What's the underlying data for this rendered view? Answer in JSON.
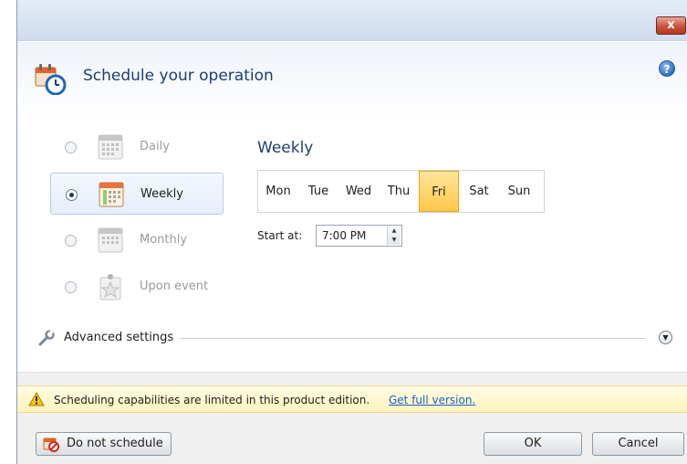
{
  "titlebar": {
    "close_label": "x"
  },
  "header": {
    "title": "Schedule your operation",
    "help_label": "?"
  },
  "schedule_options": [
    {
      "label": "Daily",
      "selected": false,
      "icon": "calendar-icon"
    },
    {
      "label": "Weekly",
      "selected": true,
      "icon": "calendar-week-icon"
    },
    {
      "label": "Monthly",
      "selected": false,
      "icon": "calendar-month-icon"
    },
    {
      "label": "Upon event",
      "selected": false,
      "icon": "event-star-icon"
    }
  ],
  "weekly": {
    "title": "Weekly",
    "days": [
      "Mon",
      "Tue",
      "Wed",
      "Thu",
      "Fri",
      "Sat",
      "Sun"
    ],
    "selected_day": "Fri",
    "start_label": "Start at:",
    "start_time": "7:00 PM"
  },
  "advanced": {
    "label": "Advanced settings",
    "icon": "wrench-icon"
  },
  "notice": {
    "text": "Scheduling capabilities are limited in this product edition.",
    "link": "Get full version."
  },
  "buttons": {
    "do_not_schedule": "Do not schedule",
    "ok": "OK",
    "cancel": "Cancel"
  },
  "colors": {
    "accent_title": "#1b3f73",
    "selected_day": "#ffc64a",
    "link": "#1a5fc6"
  }
}
